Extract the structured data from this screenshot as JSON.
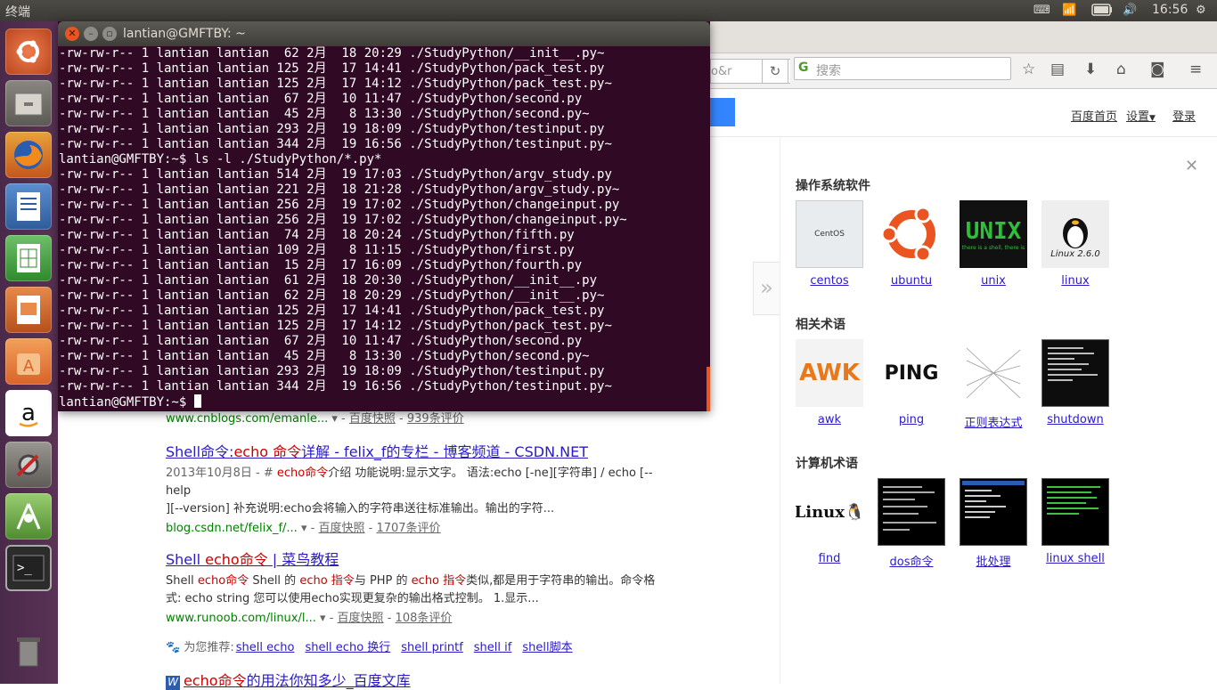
{
  "topbar": {
    "app_title": "终端",
    "time": "16:56"
  },
  "launcher": {
    "items": [
      "dash-home-icon",
      "files-icon",
      "firefox-icon",
      "writer-icon",
      "calc-icon",
      "impress-icon",
      "software-center-icon",
      "amazon-icon",
      "system-settings-icon",
      "android-studio-icon",
      "terminal-icon",
      "trash-icon"
    ]
  },
  "browser": {
    "url_fragment": "o&r",
    "search_placeholder": "搜索",
    "header_links": {
      "home": "百度首页",
      "settings": "设置",
      "login": "登录"
    }
  },
  "results": {
    "first_cite": {
      "url": "www.cnblogs.com/emanle...",
      "snapshot": "百度快照",
      "reviews": "939条评价"
    },
    "items": [
      {
        "title_pre": "Shell命令:",
        "title_em": "echo 命令",
        "title_post": "详解 - felix_f的专栏 - 博客频道 - CSDN.NET",
        "abs_line1_pre": "2013年10月8日 - # ",
        "abs_line1_em": "echo命令",
        "abs_line1_post": "介绍 功能说明:显示文字。 语法:echo [-ne][字符串] / echo [--help",
        "abs_line2": "][--version] 补充说明:echo会将输入的字符串送往标准输出。输出的字符...",
        "url": "blog.csdn.net/felix_f/...",
        "snapshot": "百度快照",
        "reviews": "1707条评价"
      },
      {
        "title_pre": "Shell ",
        "title_em": "echo命令",
        "title_post": " | 菜鸟教程",
        "abs_a": "Shell ",
        "abs_b": "echo命令",
        "abs_c": " Shell 的 ",
        "abs_d": "echo 指令",
        "abs_e": "与 PHP 的 ",
        "abs_f": "echo 指令",
        "abs_g": "类似,都是用于字符串的输出。命令格",
        "abs_line2": "式: echo string 您可以使用echo实现更复杂的输出格式控制。 1.显示...",
        "url": "www.runoob.com/linux/l...",
        "snapshot": "百度快照",
        "reviews": "108条评价"
      }
    ],
    "recommend": {
      "label": "为您推荐:",
      "links": [
        "shell echo",
        "shell echo 换行",
        "shell printf",
        "shell if",
        "shell脚本"
      ]
    },
    "wenku": {
      "title_em": "echo命令",
      "title_post": "的用法你知多少_百度文库"
    }
  },
  "panel": {
    "sections": [
      {
        "heading": "操作系统软件",
        "items": [
          "centos",
          "ubuntu",
          "unix",
          "linux"
        ]
      },
      {
        "heading": "相关术语",
        "items": [
          "awk",
          "ping",
          "正则表达式",
          "shutdown"
        ]
      },
      {
        "heading": "计算机术语",
        "items": [
          "find",
          "dos命令",
          "批处理",
          "linux shell"
        ]
      }
    ],
    "thumb_text": {
      "centos": "CentOS",
      "unix": "UNIX",
      "unix_sub": "there is a shell, there is",
      "linux": "Linux 2.6.0",
      "awk": "AWK",
      "ping": "PING",
      "find": "Linux"
    }
  },
  "terminal": {
    "title": "lantian@GMFTBY: ~",
    "lines": [
      "-rw-rw-r-- 1 lantian lantian  62 2月  18 20:29 ./StudyPython/__init__.py~",
      "-rw-rw-r-- 1 lantian lantian 125 2月  17 14:41 ./StudyPython/pack_test.py",
      "-rw-rw-r-- 1 lantian lantian 125 2月  17 14:12 ./StudyPython/pack_test.py~",
      "-rw-rw-r-- 1 lantian lantian  67 2月  10 11:47 ./StudyPython/second.py",
      "-rw-rw-r-- 1 lantian lantian  45 2月   8 13:30 ./StudyPython/second.py~",
      "-rw-rw-r-- 1 lantian lantian 293 2月  19 18:09 ./StudyPython/testinput.py",
      "-rw-rw-r-- 1 lantian lantian 344 2月  19 16:56 ./StudyPython/testinput.py~",
      "lantian@GMFTBY:~$ ls -l ./StudyPython/*.py*",
      "-rw-rw-r-- 1 lantian lantian 514 2月  19 17:03 ./StudyPython/argv_study.py",
      "-rw-rw-r-- 1 lantian lantian 221 2月  18 21:28 ./StudyPython/argv_study.py~",
      "-rw-rw-r-- 1 lantian lantian 256 2月  19 17:02 ./StudyPython/changeinput.py",
      "-rw-rw-r-- 1 lantian lantian 256 2月  19 17:02 ./StudyPython/changeinput.py~",
      "-rw-rw-r-- 1 lantian lantian  74 2月  18 20:24 ./StudyPython/fifth.py",
      "-rw-rw-r-- 1 lantian lantian 109 2月   8 11:15 ./StudyPython/first.py",
      "-rw-rw-r-- 1 lantian lantian  15 2月  17 16:09 ./StudyPython/fourth.py",
      "-rw-rw-r-- 1 lantian lantian  61 2月  18 20:30 ./StudyPython/__init__.py",
      "-rw-rw-r-- 1 lantian lantian  62 2月  18 20:29 ./StudyPython/__init__.py~",
      "-rw-rw-r-- 1 lantian lantian 125 2月  17 14:41 ./StudyPython/pack_test.py",
      "-rw-rw-r-- 1 lantian lantian 125 2月  17 14:12 ./StudyPython/pack_test.py~",
      "-rw-rw-r-- 1 lantian lantian  67 2月  10 11:47 ./StudyPython/second.py",
      "-rw-rw-r-- 1 lantian lantian  45 2月   8 13:30 ./StudyPython/second.py~",
      "-rw-rw-r-- 1 lantian lantian 293 2月  19 18:09 ./StudyPython/testinput.py",
      "-rw-rw-r-- 1 lantian lantian 344 2月  19 16:56 ./StudyPython/testinput.py~"
    ],
    "prompt": "lantian@GMFTBY:~$ "
  },
  "colors": {
    "terminal_bg": "#300a24",
    "launcher_bg": "#5a3255",
    "link": "#2a1bc6",
    "highlight": "#cc0000",
    "cite": "#008000",
    "accent": "#e95420"
  }
}
